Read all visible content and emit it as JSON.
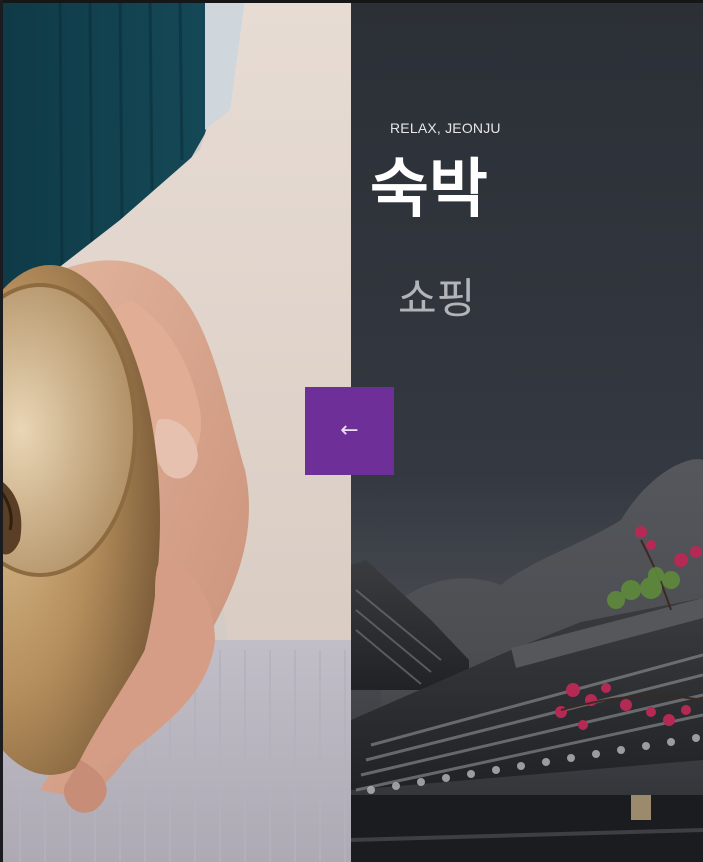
{
  "hero": {
    "eyebrow": "RELAX, JEONJU",
    "titles": [
      {
        "label": "숙박",
        "active": true
      },
      {
        "label": "쇼핑",
        "active": false
      }
    ]
  },
  "controls": {
    "prev_icon": "←",
    "prev_color": "#6f2f98"
  },
  "images": {
    "left": "bowl-in-hand-photo",
    "right": "hanok-roof-with-blossoms-photo"
  }
}
